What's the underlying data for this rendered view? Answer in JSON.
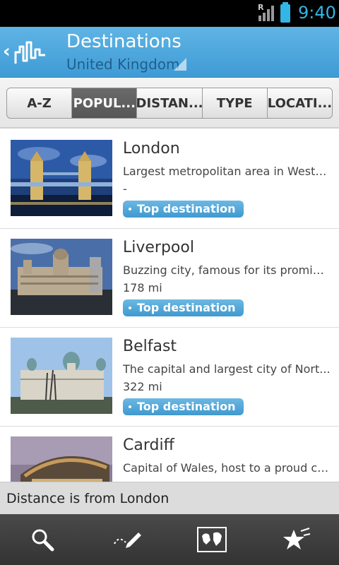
{
  "status_bar": {
    "time": "9:40",
    "roaming": "R"
  },
  "header": {
    "title": "Destinations",
    "subtitle": "United Kingdom"
  },
  "tabs": [
    {
      "label": "A-Z",
      "active": false
    },
    {
      "label": "POPUL...",
      "active": true
    },
    {
      "label": "DISTAN...",
      "active": false
    },
    {
      "label": "TYPE",
      "active": false
    },
    {
      "label": "LOCATI...",
      "active": false
    }
  ],
  "items": [
    {
      "name": "London",
      "desc": "Largest metropolitan area in Weste...",
      "dist": "-",
      "badge": "Top destination"
    },
    {
      "name": "Liverpool",
      "desc": "Buzzing city, famous for its promin...",
      "dist": "178 mi",
      "badge": "Top destination"
    },
    {
      "name": "Belfast",
      "desc": "The capital and largest city of Nort...",
      "dist": "322 mi",
      "badge": "Top destination"
    },
    {
      "name": "Cardiff",
      "desc": "Capital of Wales, host to a proud co...",
      "dist": "",
      "badge": ""
    }
  ],
  "note": {
    "text": "Distance is from London"
  },
  "bottom_nav": [
    {
      "icon": "search-icon"
    },
    {
      "icon": "edit-icon"
    },
    {
      "icon": "map-icon"
    },
    {
      "icon": "favorites-star-icon"
    }
  ]
}
